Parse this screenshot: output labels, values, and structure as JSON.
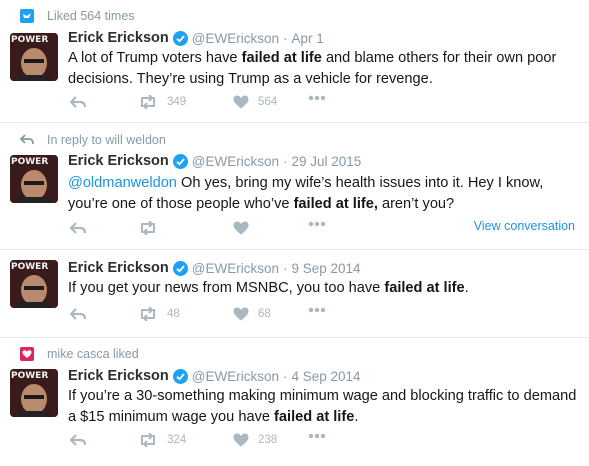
{
  "tweets": [
    {
      "context": {
        "icon": "bird-icon",
        "color": "#1da1f2",
        "text": "Liked 564 times"
      },
      "name": "Erick Erickson",
      "handle": "@EWErickson",
      "sep": "·",
      "date": "Apr 1",
      "segments": [
        {
          "t": "A lot of Trump voters have "
        },
        {
          "t": "failed at life",
          "b": true
        },
        {
          "t": " and blame others for their own poor decisions.  They’re using Trump as a vehicle for revenge."
        }
      ],
      "retweets": "349",
      "likes": "564"
    },
    {
      "context": {
        "icon": "reply-arrow-icon",
        "color": "#8899a6",
        "text": "In reply to will weldon"
      },
      "name": "Erick Erickson",
      "handle": "@EWErickson",
      "sep": "·",
      "date": "29 Jul 2015",
      "segments": [
        {
          "t": "@oldmanweldon",
          "m": true
        },
        {
          "t": " Oh yes, bring my wife’s health issues into it.  Hey I know, you’re one of those people who’ve "
        },
        {
          "t": "failed at life,",
          "b": true
        },
        {
          "t": " aren’t you?"
        }
      ],
      "retweets": "",
      "likes": "",
      "view_conversation": "View conversation"
    },
    {
      "name": "Erick Erickson",
      "handle": "@EWErickson",
      "sep": "·",
      "date": "9 Sep 2014",
      "segments": [
        {
          "t": "If you get your news from MSNBC, you too have "
        },
        {
          "t": "failed at life",
          "b": true
        },
        {
          "t": "."
        }
      ],
      "retweets": "48",
      "likes": "68"
    },
    {
      "context": {
        "icon": "heart-icon",
        "color": "#e0245e",
        "text": "mike casca liked"
      },
      "name": "Erick Erickson",
      "handle": "@EWErickson",
      "sep": "·",
      "date": "4 Sep 2014",
      "segments": [
        {
          "t": "If you’re a 30-something making minimum wage and blocking traffic to demand a $15 minimum wage you have "
        },
        {
          "t": "failed at life",
          "b": true
        },
        {
          "t": "."
        }
      ],
      "retweets": "324",
      "likes": "238"
    }
  ],
  "avatar_text": "POWER",
  "colors": {
    "link": "#1b95e0",
    "muted": "#8899a6",
    "icon": "#aab8c2",
    "verified": "#1da1f2"
  }
}
